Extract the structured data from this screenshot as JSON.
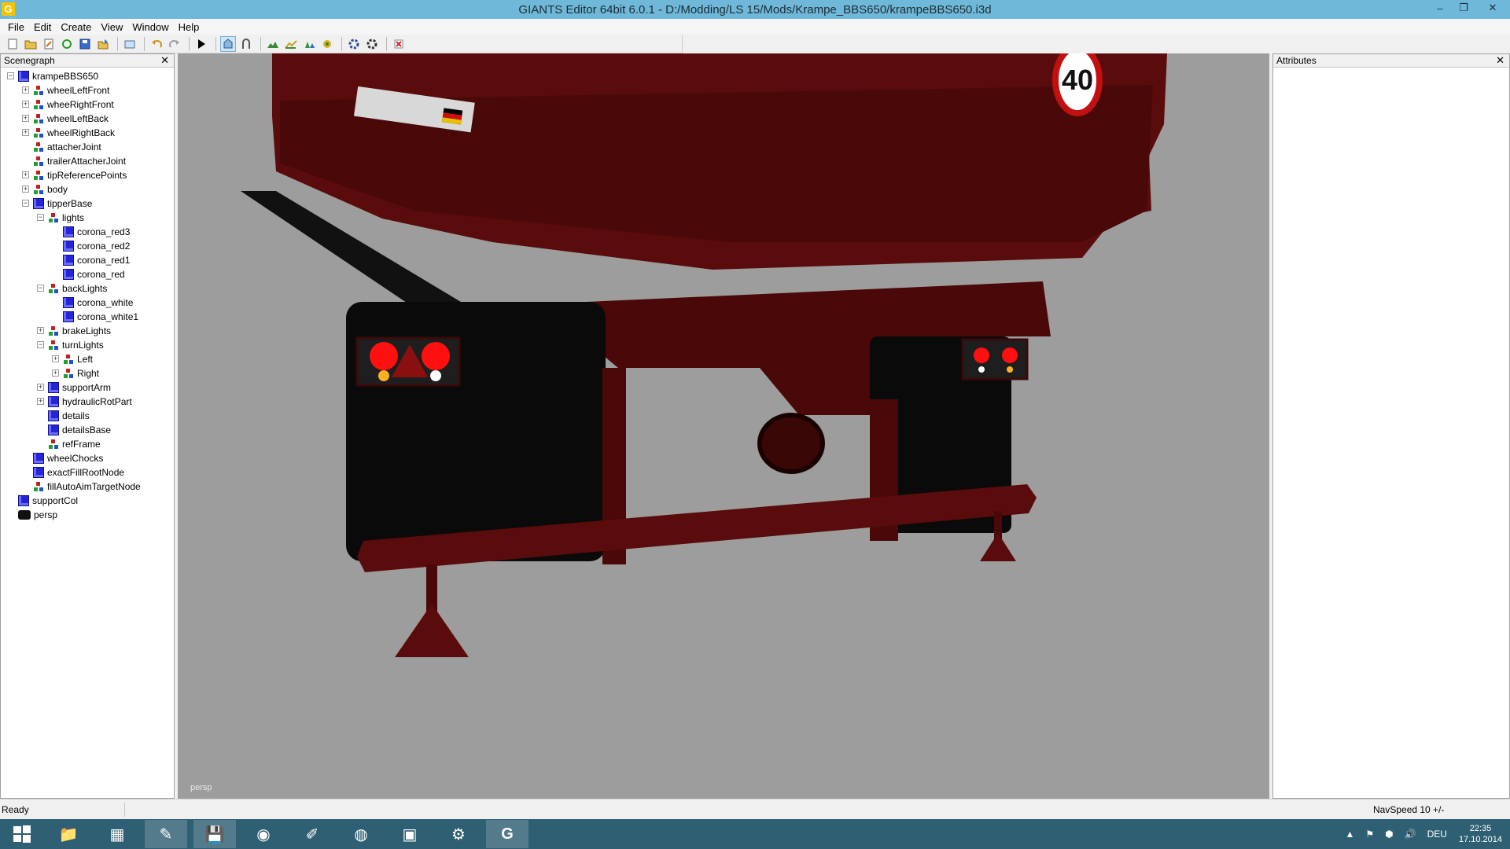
{
  "window": {
    "title": "GIANTS Editor 64bit 6.0.1 - D:/Modding/LS 15/Mods/Krampe_BBS650/krampeBBS650.i3d",
    "app_icon": "G",
    "controls": {
      "minimize": "–",
      "restore": "❐",
      "close": "✕"
    }
  },
  "menu": [
    "File",
    "Edit",
    "Create",
    "View",
    "Window",
    "Help"
  ],
  "toolbar_icons": [
    "new-file-icon",
    "open-file-icon",
    "edit-file-icon",
    "reload-icon",
    "save-icon",
    "export-icon",
    "import-icon",
    "undo-icon",
    "redo-icon",
    "play-icon",
    "select-tool-icon",
    "magnet-icon",
    "terrain-icon",
    "paint-icon",
    "foliage-icon",
    "decal-icon",
    "settings-icon",
    "settings-alt-icon",
    "delete-icon"
  ],
  "scenegraph": {
    "title": "Scenegraph",
    "close": "✕",
    "nodes": [
      {
        "label": "krampeBBS650",
        "depth": 0,
        "icon": "cube",
        "exp": "−"
      },
      {
        "label": "wheelLeftFront",
        "depth": 1,
        "icon": "tg",
        "exp": "+"
      },
      {
        "label": "wheeRightFront",
        "depth": 1,
        "icon": "tg",
        "exp": "+"
      },
      {
        "label": "wheelLeftBack",
        "depth": 1,
        "icon": "tg",
        "exp": "+"
      },
      {
        "label": "wheelRightBack",
        "depth": 1,
        "icon": "tg",
        "exp": "+"
      },
      {
        "label": "attacherJoint",
        "depth": 1,
        "icon": "tg",
        "exp": ""
      },
      {
        "label": "trailerAttacherJoint",
        "depth": 1,
        "icon": "tg",
        "exp": ""
      },
      {
        "label": "tipReferencePoints",
        "depth": 1,
        "icon": "tg",
        "exp": "+"
      },
      {
        "label": "body",
        "depth": 1,
        "icon": "tg",
        "exp": "+"
      },
      {
        "label": "tipperBase",
        "depth": 1,
        "icon": "cube",
        "exp": "−"
      },
      {
        "label": "lights",
        "depth": 2,
        "icon": "tg",
        "exp": "−"
      },
      {
        "label": "corona_red3",
        "depth": 3,
        "icon": "cube",
        "exp": ""
      },
      {
        "label": "corona_red2",
        "depth": 3,
        "icon": "cube",
        "exp": ""
      },
      {
        "label": "corona_red1",
        "depth": 3,
        "icon": "cube",
        "exp": ""
      },
      {
        "label": "corona_red",
        "depth": 3,
        "icon": "cube",
        "exp": ""
      },
      {
        "label": "backLights",
        "depth": 2,
        "icon": "tg",
        "exp": "−"
      },
      {
        "label": "corona_white",
        "depth": 3,
        "icon": "cube",
        "exp": ""
      },
      {
        "label": "corona_white1",
        "depth": 3,
        "icon": "cube",
        "exp": ""
      },
      {
        "label": "brakeLights",
        "depth": 2,
        "icon": "tg",
        "exp": "+"
      },
      {
        "label": "turnLights",
        "depth": 2,
        "icon": "tg",
        "exp": "−"
      },
      {
        "label": "Left",
        "depth": 3,
        "icon": "tg",
        "exp": "+"
      },
      {
        "label": "Right",
        "depth": 3,
        "icon": "tg",
        "exp": "+"
      },
      {
        "label": "supportArm",
        "depth": 2,
        "icon": "cube",
        "exp": "+"
      },
      {
        "label": "hydraulicRotPart",
        "depth": 2,
        "icon": "cube",
        "exp": "+"
      },
      {
        "label": "details",
        "depth": 2,
        "icon": "cube",
        "exp": ""
      },
      {
        "label": "detailsBase",
        "depth": 2,
        "icon": "cube",
        "exp": ""
      },
      {
        "label": "refFrame",
        "depth": 2,
        "icon": "tg",
        "exp": ""
      },
      {
        "label": "wheelChocks",
        "depth": 1,
        "icon": "cube",
        "exp": ""
      },
      {
        "label": "exactFillRootNode",
        "depth": 1,
        "icon": "cube",
        "exp": ""
      },
      {
        "label": "fillAutoAimTargetNode",
        "depth": 1,
        "icon": "tg",
        "exp": ""
      },
      {
        "label": "supportCol",
        "depth": 0,
        "icon": "cube",
        "exp": ""
      },
      {
        "label": "persp",
        "depth": 0,
        "icon": "cam",
        "exp": ""
      }
    ]
  },
  "viewport": {
    "camera_label": "persp",
    "speed_sign": "40",
    "colors": {
      "background": "#9d9d9d",
      "trailer_red": "#5a0c0c",
      "trailer_dark": "#3a0707",
      "light_red": "#ff1010"
    }
  },
  "attributes": {
    "title": "Attributes",
    "close": "✕"
  },
  "status": {
    "left": "Ready",
    "right": "NavSpeed 10 +/-"
  },
  "taskbar": {
    "start_icon": "windows-start-icon",
    "apps": [
      {
        "name": "file-explorer-icon",
        "glyph": "📁",
        "active": false
      },
      {
        "name": "calculator-icon",
        "glyph": "▦",
        "active": false
      },
      {
        "name": "notepad-icon",
        "glyph": "✎",
        "active": true
      },
      {
        "name": "floppy-save-icon",
        "glyph": "💾",
        "active": true
      },
      {
        "name": "chrome-icon",
        "glyph": "◉",
        "active": false
      },
      {
        "name": "paint-tool-icon",
        "glyph": "✐",
        "active": false
      },
      {
        "name": "teamspeak-icon",
        "glyph": "◍",
        "active": false
      },
      {
        "name": "store-icon",
        "glyph": "▣",
        "active": false
      },
      {
        "name": "steam-icon",
        "glyph": "⚙",
        "active": false
      },
      {
        "name": "giants-editor-icon",
        "glyph": "G",
        "active": true
      }
    ],
    "tray": {
      "language": "DEU",
      "time": "22:35",
      "date": "17.10.2014"
    }
  }
}
